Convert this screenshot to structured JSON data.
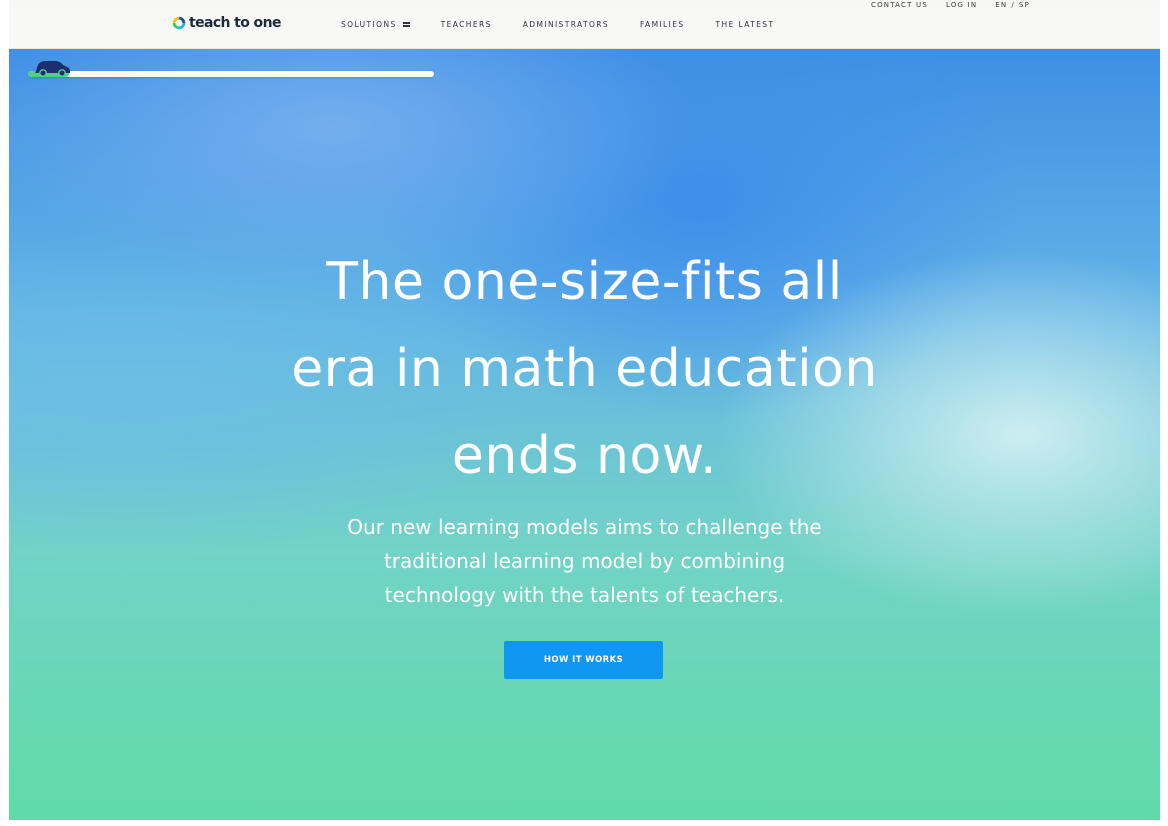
{
  "utility_bar": {
    "contact_us": "CONTACT US",
    "log_in": "LOG IN",
    "lang_en": "EN",
    "lang_sep": "/",
    "lang_sp": "SP"
  },
  "header": {
    "logo_text": "teach to one",
    "nav": [
      {
        "label": "SOLUTIONS",
        "icon": "menu-icon"
      },
      {
        "label": "TEACHERS"
      },
      {
        "label": "ADMINISTRATORS"
      },
      {
        "label": "FAMILIES"
      },
      {
        "label": "THE LATEST"
      }
    ]
  },
  "hero": {
    "progress": {
      "fraction": 0.1,
      "icon": "car-icon"
    },
    "headline": [
      "The one-size-fits all",
      "era in math education",
      "ends now."
    ],
    "subtext": [
      "Our new learning models aims to challenge the",
      "traditional learning model by combining",
      "technology with the talents of teachers."
    ],
    "cta_label": "HOW IT WORKS"
  },
  "colors": {
    "cta": "#1097f3",
    "progress_fill": "#48d48e",
    "hero_top": "#3f8fe4",
    "hero_bottom": "#60dba7"
  }
}
